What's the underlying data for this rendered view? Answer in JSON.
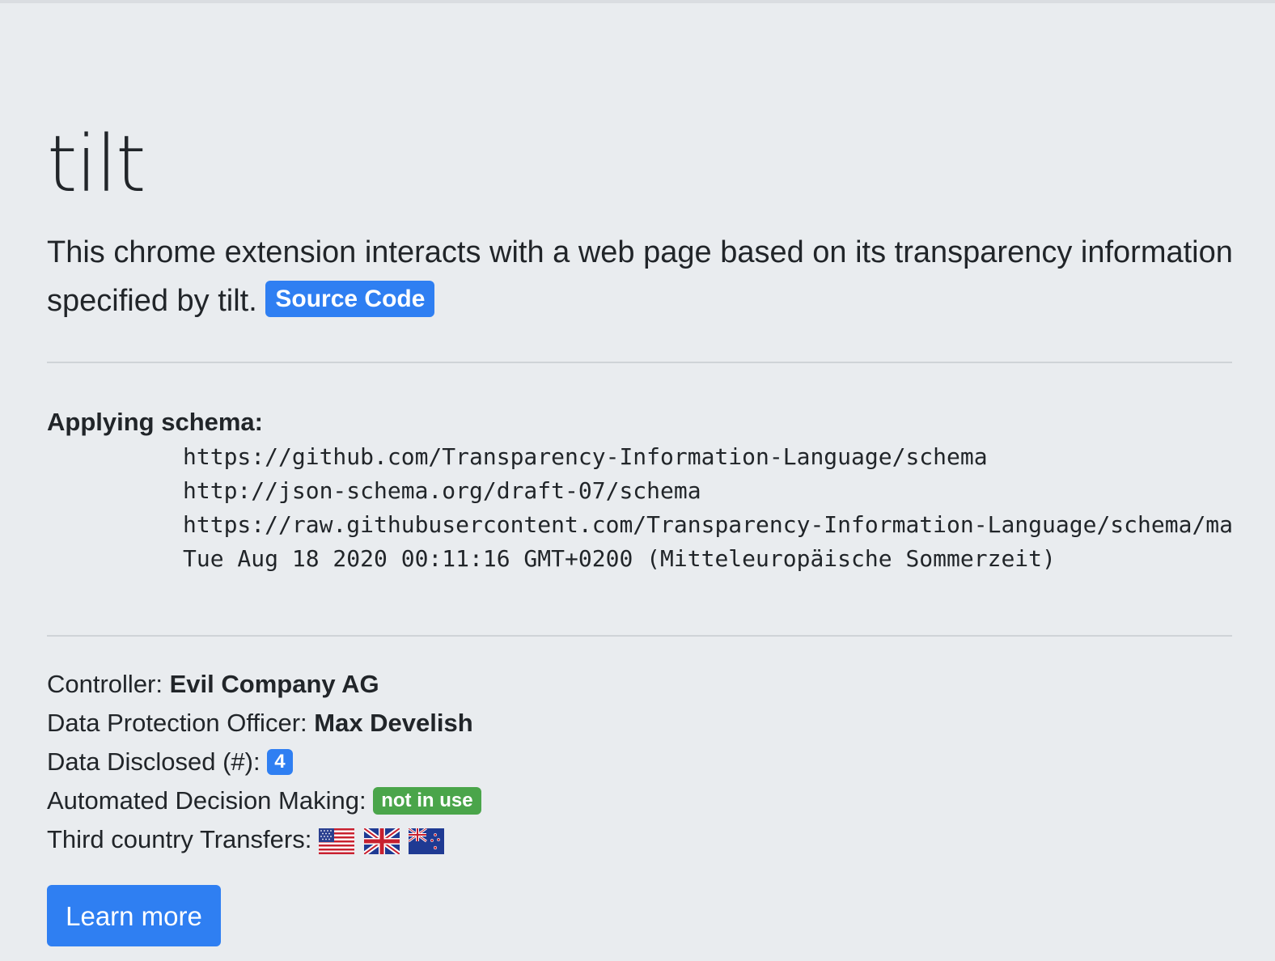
{
  "header": {
    "title": "tilt",
    "lead_text": "This chrome extension interacts with a web page based on its transparency information specified by tilt.",
    "source_code_label": "Source Code"
  },
  "schema": {
    "heading": "Applying schema:",
    "lines": [
      "https://github.com/Transparency-Information-Language/schema",
      "http://json-schema.org/draft-07/schema",
      "https://raw.githubusercontent.com/Transparency-Information-Language/schema/mas",
      "Tue Aug 18 2020 00:11:16 GMT+0200 (Mitteleuropäische Sommerzeit)"
    ]
  },
  "facts": {
    "controller_label": "Controller:",
    "controller_value": "Evil Company AG",
    "dpo_label": "Data Protection Officer:",
    "dpo_value": "Max Develish",
    "data_disclosed_label": "Data Disclosed (#):",
    "data_disclosed_count": "4",
    "adm_label": "Automated Decision Making:",
    "adm_status": "not in use",
    "transfers_label": "Third country Transfers:",
    "transfer_flags": [
      "us-flag-icon",
      "uk-flag-icon",
      "nz-flag-icon"
    ]
  },
  "actions": {
    "learn_more_label": "Learn more"
  },
  "colors": {
    "background": "#e9ecef",
    "primary": "#2f7ff2",
    "success": "#4aa54a",
    "text": "#212529"
  }
}
